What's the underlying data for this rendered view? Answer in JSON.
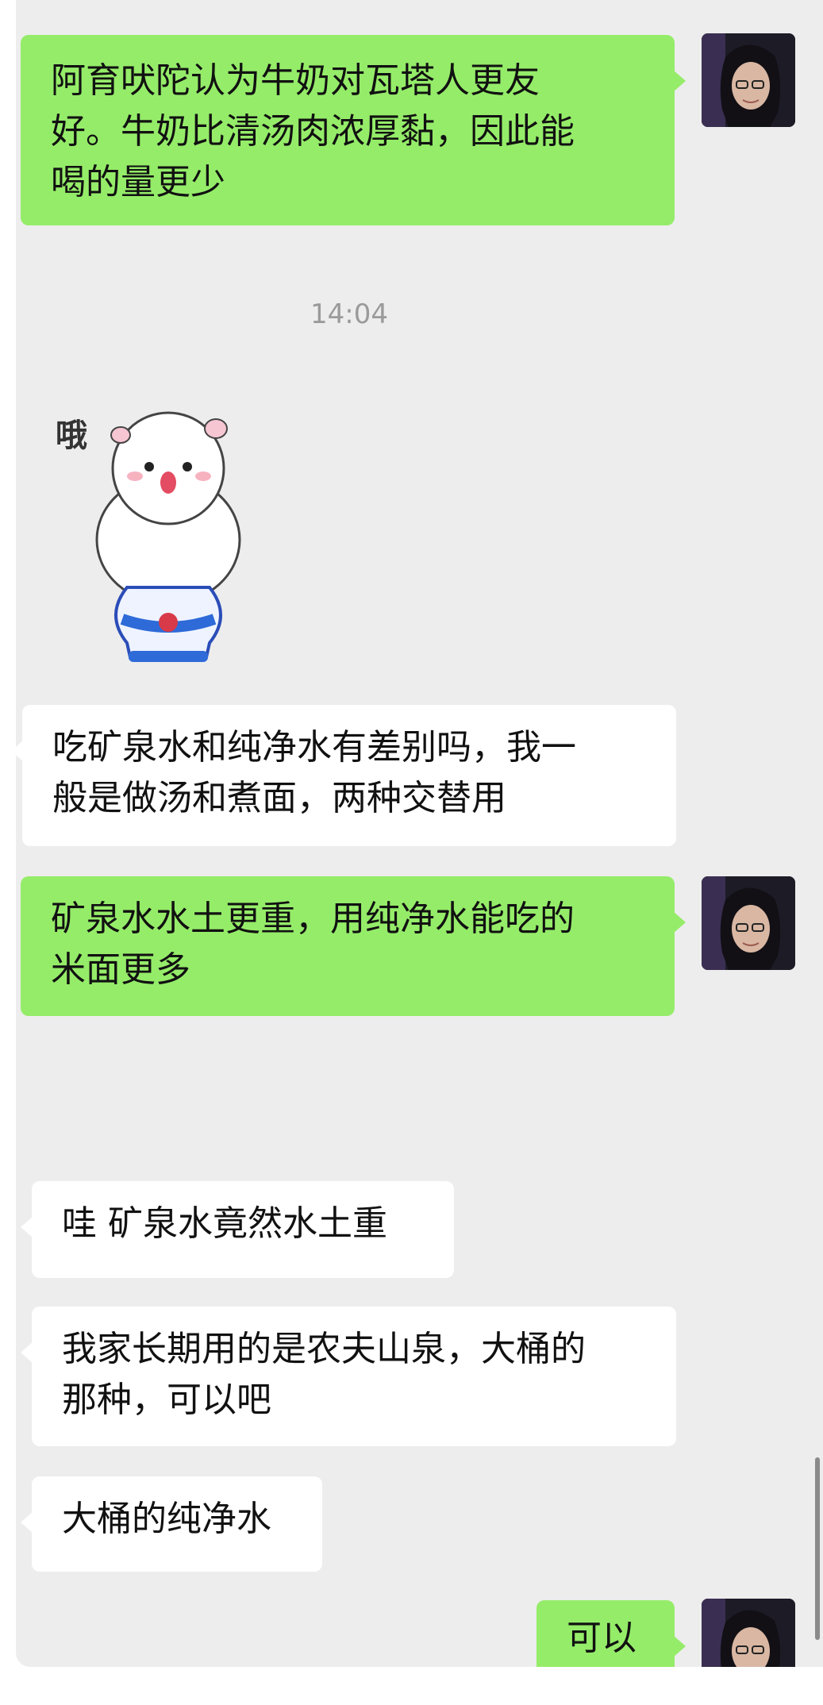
{
  "timestamp": "14:04",
  "sticker": {
    "text": "哦"
  },
  "messages": [
    {
      "side": "me",
      "text": "阿育吠陀认为牛奶对瓦塔人更友\n好。牛奶比清汤肉浓厚黏，因此能\n喝的量更少"
    },
    {
      "side": "them",
      "text": "吃矿泉水和纯净水有差别吗，我一\n般是做汤和煮面，两种交替用"
    },
    {
      "side": "me",
      "text": "矿泉水水土更重，用纯净水能吃的\n米面更多"
    },
    {
      "side": "them",
      "text": "哇 矿泉水竟然水土重"
    },
    {
      "side": "them",
      "text": "我家长期用的是农夫山泉，大桶的\n那种，可以吧"
    },
    {
      "side": "them",
      "text": "大桶的纯净水"
    },
    {
      "side": "me",
      "text": "可以"
    }
  ]
}
